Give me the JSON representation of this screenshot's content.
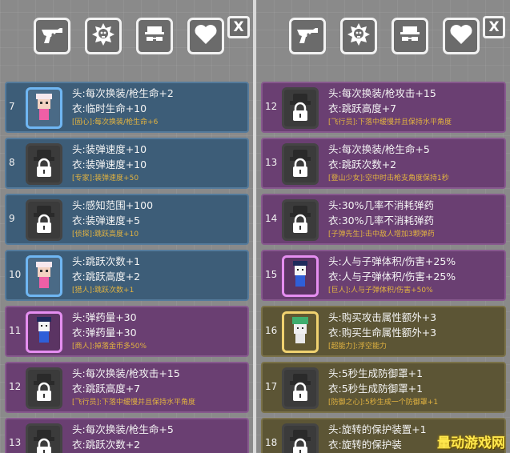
{
  "tab_icons": [
    "revolver-icon",
    "skull-badge-icon",
    "hat-glasses-icon",
    "heart-icon"
  ],
  "close_label": "X",
  "colors": {
    "blue": "#3d5d78",
    "purple": "#6a3f72",
    "gold": "#5c5535",
    "bonus_text": "#e2b340"
  },
  "left_items": [
    {
      "num": "7",
      "head": "头:每次换装/枪生命+2",
      "body": "衣:临时生命+10",
      "bonus": "[固心]:每次换装/枪生命+6",
      "color": "blue",
      "locked": false
    },
    {
      "num": "8",
      "head": "头:装弹速度+10",
      "body": "衣:装弹速度+10",
      "bonus": "[专家]:装弹速度+50",
      "color": "blue",
      "locked": true
    },
    {
      "num": "9",
      "head": "头:感知范围+100",
      "body": "衣:装弹速度+5",
      "bonus": "[侦探]:跳跃高度+10",
      "color": "blue",
      "locked": true
    },
    {
      "num": "10",
      "head": "头:跳跃次数+1",
      "body": "衣:跳跃高度+2",
      "bonus": "[猎人]:跳跃次数+1",
      "color": "blue",
      "locked": false
    },
    {
      "num": "11",
      "head": "头:弹药量+30",
      "body": "衣:弹药量+30",
      "bonus": "[商人]:掉落金币多50%",
      "color": "purple",
      "locked": false
    },
    {
      "num": "12",
      "head": "头:每次换装/枪攻击+15",
      "body": "衣:跳跃高度+7",
      "bonus": "[飞行员]:下落中缓慢并且保持水平角度",
      "color": "purple",
      "locked": true
    },
    {
      "num": "13",
      "head": "头:每次换装/枪生命+5",
      "body": "衣:跳跃次数+2",
      "bonus": "",
      "color": "purple",
      "locked": true
    }
  ],
  "right_items": [
    {
      "num": "12",
      "head": "头:每次换装/枪攻击+15",
      "body": "衣:跳跃高度+7",
      "bonus": "[飞行员]:下落中缓慢并且保持水平角度",
      "color": "purple",
      "locked": true
    },
    {
      "num": "13",
      "head": "头:每次换装/枪生命+5",
      "body": "衣:跳跃次数+2",
      "bonus": "[登山少女]:空中时击枪支角度保持1秒",
      "color": "purple",
      "locked": true
    },
    {
      "num": "14",
      "head": "头:30%几率不消耗弹药",
      "body": "衣:30%几率不消耗弹药",
      "bonus": "[子弹先生]:击中敌人增加3颗弹药",
      "color": "purple",
      "locked": true
    },
    {
      "num": "15",
      "head": "头:人与子弹体积/伤害+25%",
      "body": "衣:人与子弹体积/伤害+25%",
      "bonus": "[巨人]:人与子弹体积/伤害+50%",
      "color": "purple",
      "locked": false
    },
    {
      "num": "16",
      "head": "头:购买攻击属性额外+3",
      "body": "衣:购买生命属性额外+3",
      "bonus": "[超能力]:浮空能力",
      "color": "gold",
      "locked": false
    },
    {
      "num": "17",
      "head": "头:5秒生成防御罩+1",
      "body": "衣:5秒生成防御罩+1",
      "bonus": "[防御之心]:5秒生成一个防御罩+1",
      "color": "gold",
      "locked": true
    },
    {
      "num": "18",
      "head": "头:旋转的保护装置+1",
      "body": "衣:旋转的保护装",
      "bonus": "",
      "color": "gold",
      "locked": true
    }
  ],
  "watermark": "量动游戏网"
}
